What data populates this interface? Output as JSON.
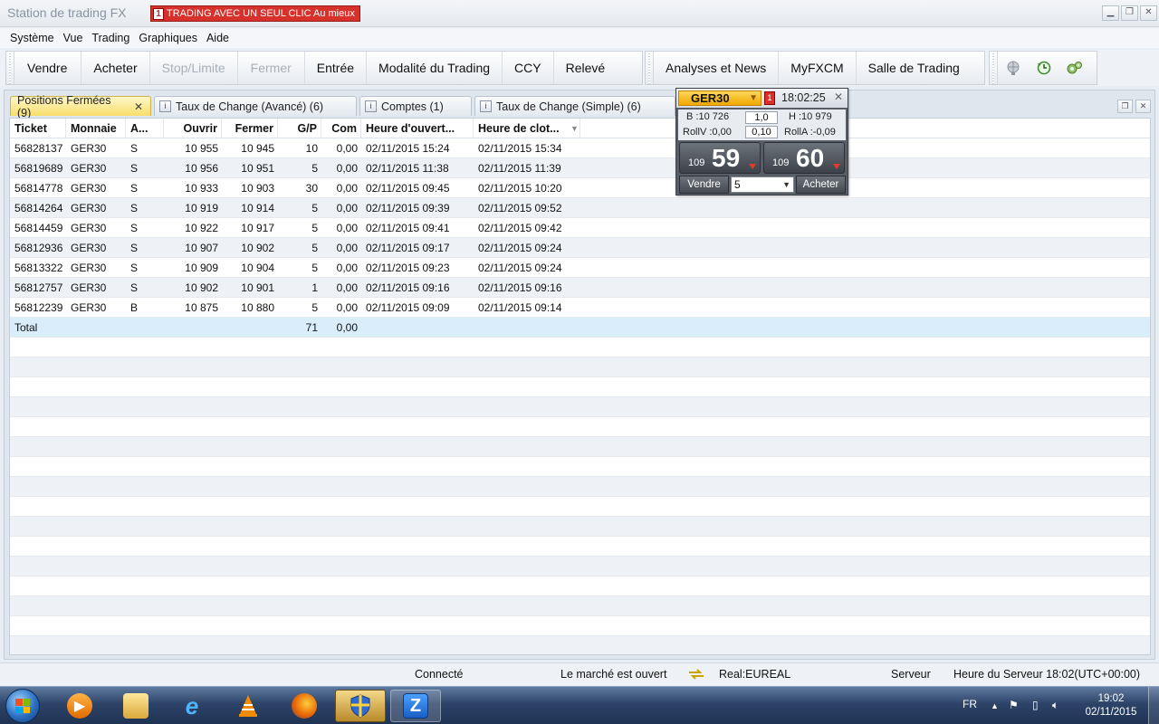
{
  "window": {
    "title": "Station de trading FX",
    "promo_badge": "TRADING AVEC UN SEUL CLIC Au mieux",
    "promo_badge_num": "1",
    "controls": [
      "minimize",
      "restore",
      "close"
    ]
  },
  "menu": [
    "Système",
    "Vue",
    "Trading",
    "Graphiques",
    "Aide"
  ],
  "toolbar": {
    "group1": [
      {
        "label": "Vendre",
        "enabled": true
      },
      {
        "label": "Acheter",
        "enabled": true
      },
      {
        "label": "Stop/Limite",
        "enabled": false
      },
      {
        "label": "Fermer",
        "enabled": false
      },
      {
        "label": "Entrée",
        "enabled": true
      },
      {
        "label": "Modalité du Trading",
        "enabled": true
      },
      {
        "label": "CCY",
        "enabled": true
      },
      {
        "label": "Relevé",
        "enabled": true
      }
    ],
    "group2": [
      {
        "label": "Analyses et News"
      },
      {
        "label": "MyFXCM"
      },
      {
        "label": "Salle de Trading"
      }
    ],
    "icons": [
      "globe-icon",
      "clock-refresh-icon",
      "gears-icon"
    ]
  },
  "tabs": [
    {
      "label": "Positions Fermées (9)",
      "active": true,
      "closable": true
    },
    {
      "label": "Taux de Change (Avancé) (6)",
      "active": false
    },
    {
      "label": "Comptes (1)",
      "active": false
    },
    {
      "label": "Taux de Change (Simple) (6)",
      "active": false
    }
  ],
  "grid": {
    "columns": [
      {
        "label": "Ticket"
      },
      {
        "label": "Monnaie"
      },
      {
        "label": "A..."
      },
      {
        "label": "Ouvrir"
      },
      {
        "label": "Fermer"
      },
      {
        "label": "G/P"
      },
      {
        "label": "Com"
      },
      {
        "label": "Heure d'ouvert..."
      },
      {
        "label": "Heure de clot..."
      }
    ],
    "rows": [
      [
        "56828137",
        "GER30",
        "S",
        "10 955",
        "10 945",
        "10",
        "0,00",
        "02/11/2015 15:24",
        "02/11/2015 15:34"
      ],
      [
        "56819689",
        "GER30",
        "S",
        "10 956",
        "10 951",
        "5",
        "0,00",
        "02/11/2015 11:38",
        "02/11/2015 11:39"
      ],
      [
        "56814778",
        "GER30",
        "S",
        "10 933",
        "10 903",
        "30",
        "0,00",
        "02/11/2015 09:45",
        "02/11/2015 10:20"
      ],
      [
        "56814264",
        "GER30",
        "S",
        "10 919",
        "10 914",
        "5",
        "0,00",
        "02/11/2015 09:39",
        "02/11/2015 09:52"
      ],
      [
        "56814459",
        "GER30",
        "S",
        "10 922",
        "10 917",
        "5",
        "0,00",
        "02/11/2015 09:41",
        "02/11/2015 09:42"
      ],
      [
        "56812936",
        "GER30",
        "S",
        "10 907",
        "10 902",
        "5",
        "0,00",
        "02/11/2015 09:17",
        "02/11/2015 09:24"
      ],
      [
        "56813322",
        "GER30",
        "S",
        "10 909",
        "10 904",
        "5",
        "0,00",
        "02/11/2015 09:23",
        "02/11/2015 09:24"
      ],
      [
        "56812757",
        "GER30",
        "S",
        "10 902",
        "10 901",
        "1",
        "0,00",
        "02/11/2015 09:16",
        "02/11/2015 09:16"
      ],
      [
        "56812239",
        "GER30",
        "B",
        "10 875",
        "10 880",
        "5",
        "0,00",
        "02/11/2015 09:09",
        "02/11/2015 09:14"
      ]
    ],
    "total": {
      "label": "Total",
      "gp": "71",
      "com": "0,00"
    }
  },
  "ticket": {
    "symbol": "GER30",
    "badge": "1",
    "time": "18:02:25",
    "low": "B :10 726",
    "high": "H :10 979",
    "pip_cost": "1,0",
    "roll_sell": "RollV :0,00",
    "roll_buy": "RollA :-0,09",
    "spread": "0,10",
    "sell": {
      "prefix": "109",
      "big": "59"
    },
    "buy": {
      "prefix": "109",
      "big": "60"
    },
    "sell_label": "Vendre",
    "buy_label": "Acheter",
    "lot": "5"
  },
  "status": {
    "connection": "Connecté",
    "market": "Le marché est ouvert",
    "account": "Real:EUREAL",
    "server": "Serveur",
    "server_time": "Heure du Serveur 18:02(UTC+00:00)"
  },
  "taskbar": {
    "apps": [
      "windows-media-player",
      "file-explorer",
      "internet-explorer",
      "vlc",
      "firefox",
      "security-shield",
      "trading-station"
    ],
    "lang": "FR",
    "time": "19:02",
    "date": "02/11/2015"
  }
}
